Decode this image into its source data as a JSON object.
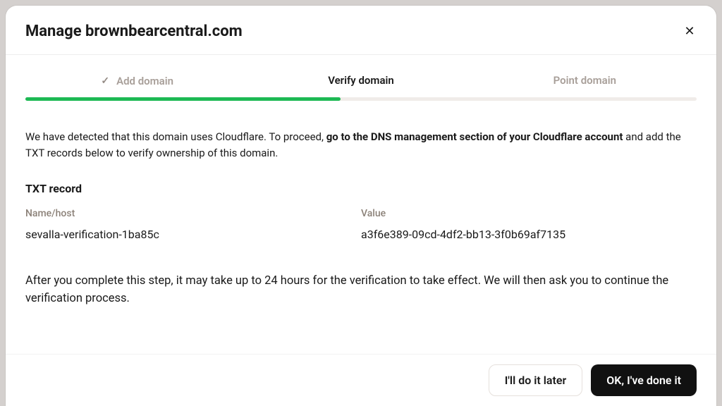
{
  "modal": {
    "title": "Manage brownbearcentral.com"
  },
  "steps": [
    {
      "label": "Add domain",
      "done": true
    },
    {
      "label": "Verify domain",
      "active": true
    },
    {
      "label": "Point domain"
    }
  ],
  "instructions": {
    "pre": "We have detected that this domain uses Cloudflare. To proceed, ",
    "bold": "go to the DNS management section of your Cloudflare account",
    "post": " and add the TXT records below to verify ownership of this domain."
  },
  "txt_section_heading": "TXT record",
  "record": {
    "name_label": "Name/host",
    "name_value": "sevalla-verification-1ba85c",
    "value_label": "Value",
    "value_value": "a3f6e389-09cd-4df2-bb13-3f0b69af7135"
  },
  "footer_text": "After you complete this step, it may take up to 24 hours for the verification to take effect. We will then ask you to continue the verification process.",
  "buttons": {
    "later": "I'll do it later",
    "done": "OK, I've done it"
  }
}
